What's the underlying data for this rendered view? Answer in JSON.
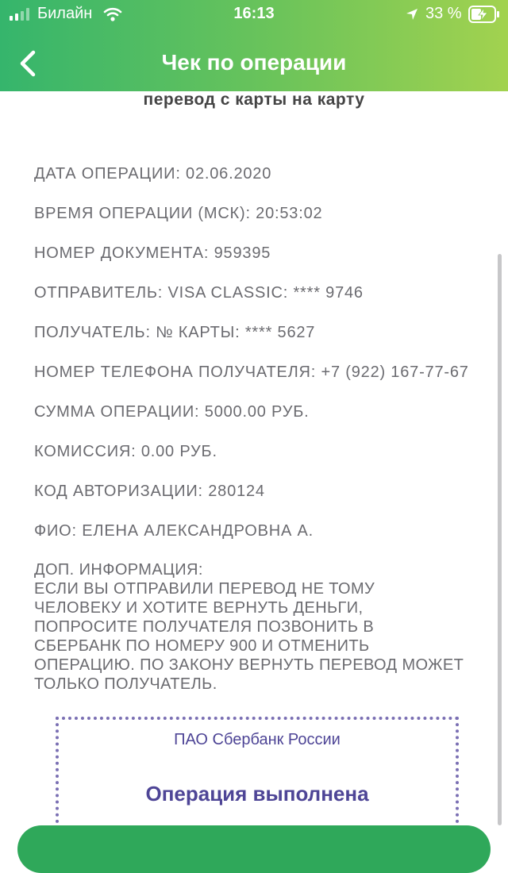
{
  "status_bar": {
    "carrier": "Билайн",
    "time": "16:13",
    "battery_percent": "33 %"
  },
  "header": {
    "title": "Чек по операции"
  },
  "receipt": {
    "transfer_type": "перевод с карты на карту",
    "rows": [
      "ДАТА ОПЕРАЦИИ: 02.06.2020",
      "ВРЕМЯ ОПЕРАЦИИ (МСК): 20:53:02",
      "НОМЕР ДОКУМЕНТА: 959395",
      "ОТПРАВИТЕЛЬ: VISA CLASSIC: **** 9746",
      "ПОЛУЧАТЕЛЬ: № КАРТЫ: **** 5627",
      "НОМЕР ТЕЛЕФОНА ПОЛУЧАТЕЛЯ: +7 (922) 167-77-67",
      "СУММА ОПЕРАЦИИ: 5000.00 РУБ.",
      "КОМИССИЯ: 0.00 РУБ.",
      "КОД АВТОРИЗАЦИИ: 280124",
      "ФИО: ЕЛЕНА АЛЕКСАНДРОВНА А."
    ],
    "extra_info_lines": [
      "ДОП. ИНФОРМАЦИЯ:",
      "ЕСЛИ ВЫ ОТПРАВИЛИ ПЕРЕВОД НЕ ТОМУ",
      "ЧЕЛОВЕКУ И ХОТИТЕ ВЕРНУТЬ ДЕНЬГИ,",
      "ПОПРОСИТЕ ПОЛУЧАТЕЛЯ ПОЗВОНИТЬ В",
      "СБЕРБАНК ПО НОМЕРУ 900 И ОТМЕНИТЬ",
      "ОПЕРАЦИЮ. ПО ЗАКОНУ ВЕРНУТЬ ПЕРЕВОД МОЖЕТ",
      "ТОЛЬКО ПОЛУЧАТЕЛЬ."
    ]
  },
  "stamp": {
    "bank_name": "ПАО Сбербанк России",
    "status": "Операция выполнена"
  },
  "colors": {
    "header_gradient_start": "#35b56c",
    "header_gradient_end": "#a2d24f",
    "stamp": "#4e4596",
    "button": "#2fa85a"
  }
}
